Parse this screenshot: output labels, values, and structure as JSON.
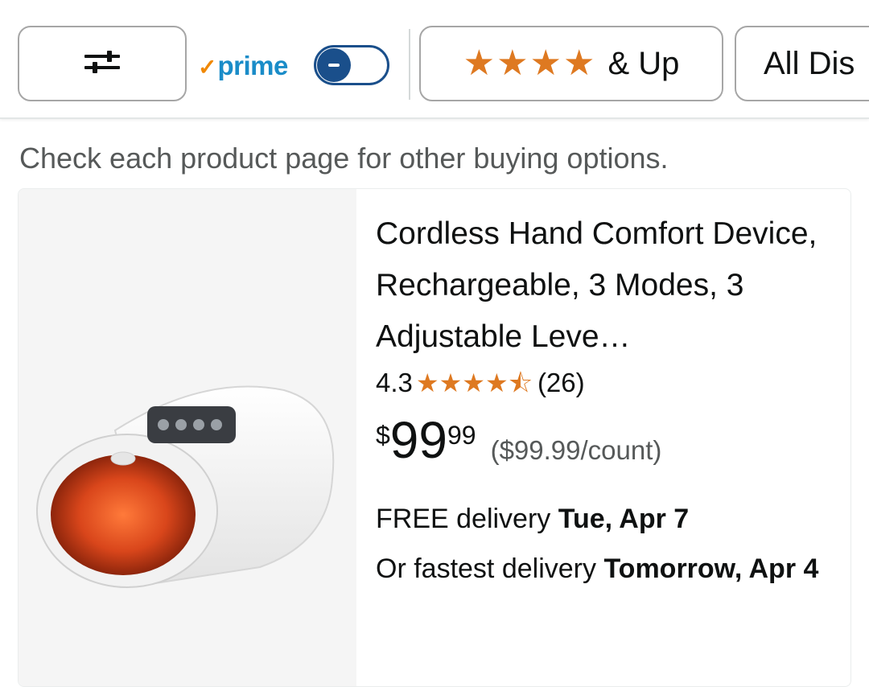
{
  "filters": {
    "filter_icon": "sliders-icon",
    "prime_label": "prime",
    "prime_toggle_on": false,
    "rating_label": "& Up",
    "rating_stars": 4,
    "all_discounts_label": "All Dis"
  },
  "notice": "Check each product page for other buying options.",
  "product": {
    "title": "Cordless Hand Comfort Device, Rechargeable, 3 Modes, 3 Adjustable Leve…",
    "rating": "4.3",
    "rating_value": 4.3,
    "review_count": "(26)",
    "price_symbol": "$",
    "price_whole": "99",
    "price_fraction": "99",
    "unit_price": "($99.99/count)",
    "delivery_prefix": "FREE delivery",
    "delivery_date": "Tue, Apr 7",
    "fastest_prefix": "Or fastest delivery",
    "fastest_date": "Tomorrow, Apr 4"
  },
  "colors": {
    "star": "#de7921",
    "prime_blue": "#1a8cc8",
    "prime_check": "#f08804",
    "toggle": "#1a4f8b",
    "text": "#0f1111",
    "secondary_text": "#565959"
  }
}
